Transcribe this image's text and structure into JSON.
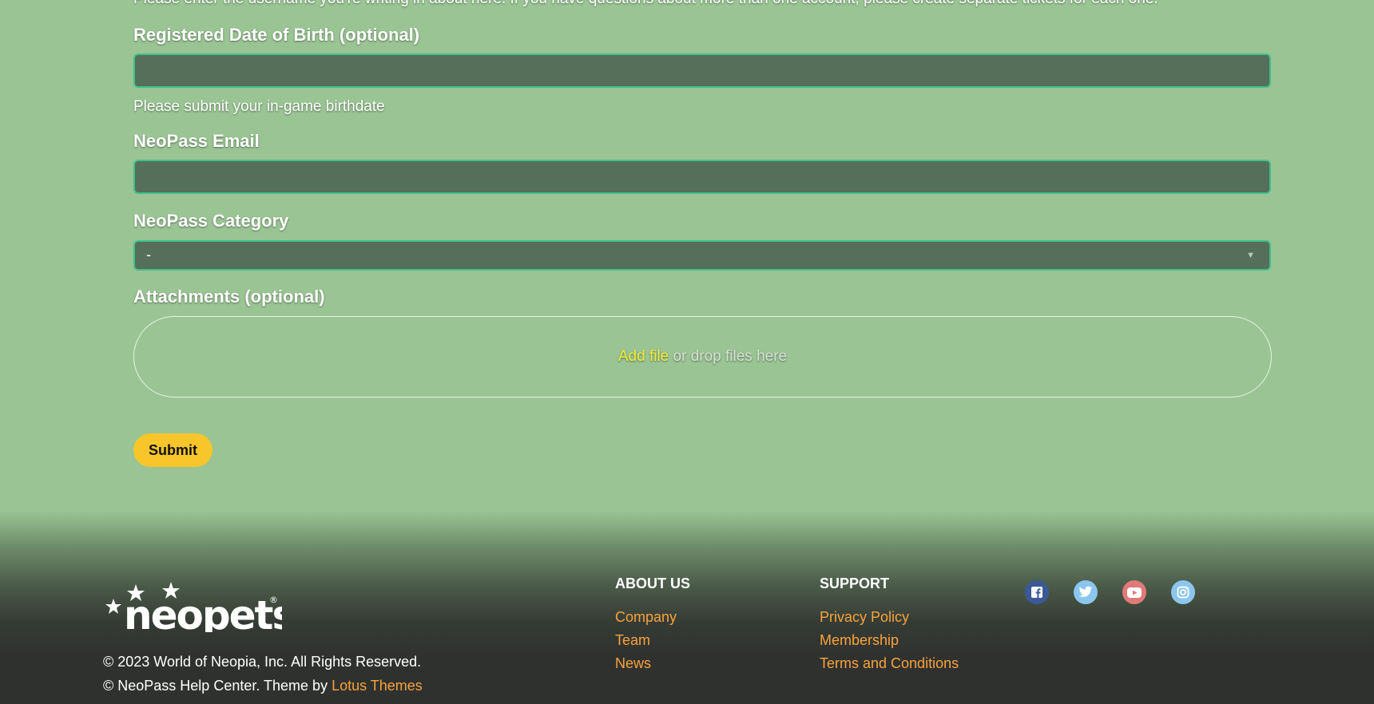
{
  "form": {
    "intro_text": "Please enter the username you're writing in about here. If you have questions about more than one account, please create separate tickets for each one.",
    "dob_label": "Registered Date of Birth (optional)",
    "dob_value": "",
    "dob_hint": "Please submit your in-game birthdate",
    "email_label": "NeoPass Email",
    "email_value": "",
    "category_label": "NeoPass Category",
    "category_selected": "-",
    "attachments_label": "Attachments (optional)",
    "add_file_link": "Add file",
    "drop_text": " or drop files here",
    "submit_label": "Submit"
  },
  "footer": {
    "logo_alt": "neopets",
    "copyright_line1": "© 2023 World of Neopia, Inc. All Rights Reserved.",
    "copyright_line2_prefix": "© NeoPass Help Center. Theme by ",
    "theme_credit_link": "Lotus Themes",
    "about_heading": "ABOUT US",
    "about_links": [
      "Company",
      "Team",
      "News"
    ],
    "support_heading": "SUPPORT",
    "support_links": [
      "Privacy Policy",
      "Membership",
      "Terms and Conditions"
    ],
    "social": [
      "facebook-icon",
      "twitter-icon",
      "youtube-icon",
      "instagram-icon"
    ]
  },
  "colors": {
    "page_bg": "#9ac494",
    "input_bg": "#566f5a",
    "input_border": "#3fc08a",
    "submit_bg": "#f8c62a",
    "link_orange": "#f9a23c",
    "add_file_yellow": "#f3ec3a",
    "footer_bg": "#2f312f"
  }
}
